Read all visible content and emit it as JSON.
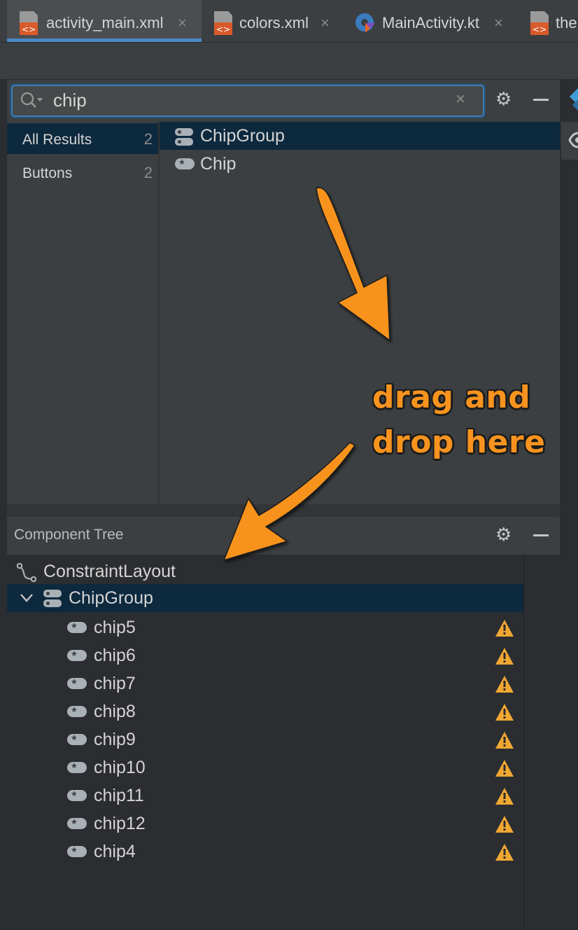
{
  "tabs": [
    {
      "label": "activity_main.xml",
      "icon": "xml-file-icon",
      "active": true
    },
    {
      "label": "colors.xml",
      "icon": "xml-file-icon",
      "active": false
    },
    {
      "label": "MainActivity.kt",
      "icon": "kotlin-file-icon",
      "active": false
    },
    {
      "label": "the",
      "icon": "xml-file-icon",
      "active": false
    }
  ],
  "close_glyph": "×",
  "palette": {
    "search_value": "chip",
    "clear_glyph": "×",
    "categories": [
      {
        "label": "All Results",
        "count": "2",
        "selected": true
      },
      {
        "label": "Buttons",
        "count": "2",
        "selected": false
      }
    ],
    "results": [
      {
        "label": "ChipGroup",
        "icon": "chipgroup-icon",
        "selected": true
      },
      {
        "label": "Chip",
        "icon": "chip-icon",
        "selected": false
      }
    ]
  },
  "annotation": {
    "line1": "drag and",
    "line2": "drop here",
    "color": "#f7931e"
  },
  "component_tree": {
    "title": "Component Tree",
    "root": "ConstraintLayout",
    "group": "ChipGroup",
    "children": [
      "chip5",
      "chip6",
      "chip7",
      "chip8",
      "chip9",
      "chip10",
      "chip11",
      "chip12",
      "chip4"
    ]
  },
  "colors": {
    "selection": "#0d293e",
    "accent": "#4a88c7",
    "warning": "#f0a732",
    "xml_icon": "#d95b2b"
  }
}
